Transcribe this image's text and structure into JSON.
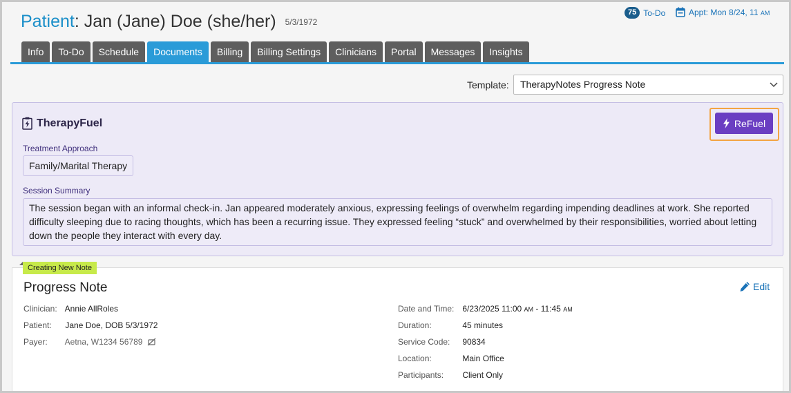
{
  "header": {
    "patient_label": "Patient",
    "patient_name": "Jan (Jane) Doe (she/her)",
    "dob": "5/3/1972",
    "todo_count": "75",
    "todo_label": "To-Do",
    "appt_label": "Appt: Mon 8/24, 11",
    "appt_suffix": "AM"
  },
  "tabs": [
    {
      "label": "Info"
    },
    {
      "label": "To-Do"
    },
    {
      "label": "Schedule"
    },
    {
      "label": "Documents",
      "active": true
    },
    {
      "label": "Billing"
    },
    {
      "label": "Billing Settings"
    },
    {
      "label": "Clinicians"
    },
    {
      "label": "Portal"
    },
    {
      "label": "Messages"
    },
    {
      "label": "Insights"
    }
  ],
  "template": {
    "label": "Template:",
    "value": "TherapyNotes Progress Note"
  },
  "therapyfuel": {
    "title": "TherapyFuel",
    "refuel_label": "ReFuel",
    "approach_label": "Treatment Approach",
    "approach_value": "Family/Marital Therapy",
    "summary_label": "Session Summary",
    "summary_text": "The session began with an informal check-in. Jan appeared moderately anxious, expressing feelings of overwhelm regarding impending deadlines at work. She reported difficulty sleeping due to racing thoughts, which has been a recurring issue. They expressed feeling “stuck” and overwhelmed by their responsibilities, worried about letting down the people they interact with every day."
  },
  "note": {
    "badge": "Creating New Note",
    "title": "Progress Note",
    "edit_label": "Edit",
    "clinician_label": "Clinician:",
    "clinician_value": "Annie AllRoles",
    "patient_label": "Patient:",
    "patient_value": "Jane Doe, DOB 5/3/1972",
    "payer_label": "Payer:",
    "payer_value": "Aetna, W1234 56789",
    "datetime_label": "Date and Time:",
    "datetime_date": "6/23/2025 11:00",
    "datetime_am1": "AM",
    "datetime_sep": " - 11:45",
    "datetime_am2": "AM",
    "duration_label": "Duration:",
    "duration_value": "45 minutes",
    "service_label": "Service Code:",
    "service_value": "90834",
    "location_label": "Location:",
    "location_value": "Main Office",
    "participants_label": "Participants:",
    "participants_value": "Client Only"
  },
  "colors": {
    "accent_blue": "#2a9bd8",
    "tab_gray": "#5e5e5e",
    "fuel_purple": "#6a3ec2",
    "highlight_orange": "#f3a442",
    "badge_green": "#c7ea4a"
  },
  "icons": {
    "calendar": "calendar-icon",
    "fuel": "clipboard-bolt-icon",
    "refuel": "bolt-icon",
    "edit": "pencil-icon",
    "payer_status": "no-verify-icon",
    "select": "chevron-down-icon"
  }
}
